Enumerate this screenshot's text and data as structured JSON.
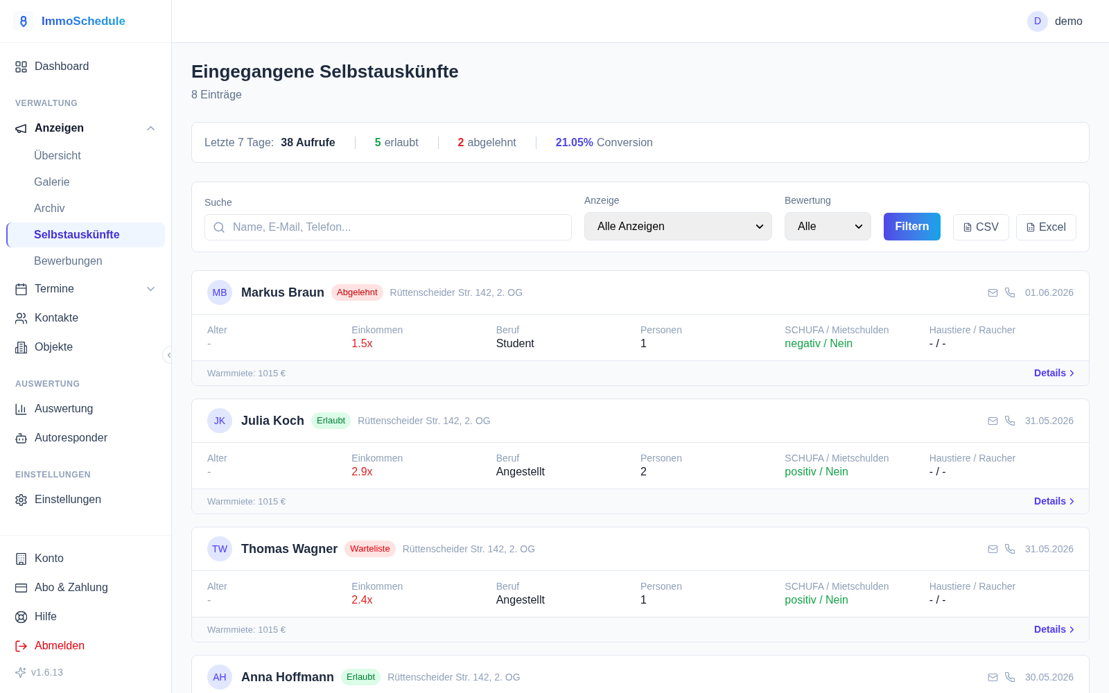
{
  "brand": {
    "name": "ImmoSchedule"
  },
  "sidebar": {
    "top": [
      {
        "label": "Dashboard",
        "selected": false
      }
    ],
    "groups": [
      {
        "heading": "VERWALTUNG",
        "items": [
          {
            "label": "Anzeigen",
            "selected": false,
            "expanded": true,
            "children": [
              {
                "label": "Übersicht",
                "selected": false
              },
              {
                "label": "Galerie",
                "selected": false
              },
              {
                "label": "Archiv",
                "selected": false
              },
              {
                "label": "Selbstauskünfte",
                "selected": true
              },
              {
                "label": "Bewerbungen",
                "selected": false
              }
            ]
          },
          {
            "label": "Termine",
            "selected": false,
            "expanded": false
          },
          {
            "label": "Kontakte",
            "selected": false
          },
          {
            "label": "Objekte",
            "selected": false
          }
        ]
      },
      {
        "heading": "AUSWERTUNG",
        "items": [
          {
            "label": "Auswertung",
            "selected": false
          },
          {
            "label": "Autoresponder",
            "selected": false
          }
        ]
      },
      {
        "heading": "EINSTELLUNGEN",
        "items": [
          {
            "label": "Einstellungen",
            "selected": false
          }
        ]
      }
    ],
    "bottom": [
      {
        "label": "Konto",
        "kind": "normal"
      },
      {
        "label": "Abo & Zahlung",
        "kind": "normal"
      },
      {
        "label": "Hilfe",
        "kind": "normal"
      },
      {
        "label": "Abmelden",
        "kind": "danger"
      }
    ],
    "version": "v1.6.13"
  },
  "user": {
    "initial": "D",
    "name": "demo"
  },
  "page": {
    "title": "Eingegangene Selbstauskünfte",
    "subtitle": "8 Einträge"
  },
  "stats": {
    "label": "Letzte 7 Tage:",
    "total": "38 Aufrufe",
    "items": [
      {
        "value": "5",
        "label": "erlaubt",
        "color": "#16a34a"
      },
      {
        "value": "2",
        "label": "abgelehnt",
        "color": "#dc2626"
      },
      {
        "value": "21.05%",
        "label": "Conversion",
        "color": "#4f46e5"
      }
    ]
  },
  "filters": {
    "search": {
      "label": "Suche",
      "placeholder": "Name, E-Mail, Telefon..."
    },
    "dropdowns": [
      {
        "label": "Anzeige",
        "value": "Alle Anzeigen"
      },
      {
        "label": "Bewertung",
        "value": "Alle"
      }
    ],
    "submit": "Filtern",
    "exports": [
      {
        "label": "CSV",
        "kind": "text"
      },
      {
        "label": "Excel",
        "kind": "sheet"
      }
    ]
  },
  "entries": [
    {
      "initials": "MB",
      "name": "Markus Braun",
      "status": {
        "label": "Abgelehnt",
        "kind": "rejected"
      },
      "address": "Rüttenscheider Str. 142, 2. OG",
      "date": "01.06.2026",
      "fields": [
        {
          "label": "Alter",
          "value": "-",
          "color": "#9ca3af"
        },
        {
          "label": "Einkommen",
          "value": "1.5x",
          "color": "#dc2626"
        },
        {
          "label": "Beruf",
          "value": "Student",
          "color": "#111827"
        },
        {
          "label": "Personen",
          "value": "1",
          "color": "#111827"
        },
        {
          "label": "SCHUFA / Mietschulden",
          "value": "negativ / Nein",
          "color": "#16a34a"
        },
        {
          "label": "Haustiere / Raucher",
          "value": "- / -",
          "color": "#111827"
        }
      ],
      "rent": "Warmmiete: 1015 €",
      "details": "Details"
    },
    {
      "initials": "JK",
      "name": "Julia Koch",
      "status": {
        "label": "Erlaubt",
        "kind": "approved"
      },
      "address": "Rüttenscheider Str. 142, 2. OG",
      "date": "31.05.2026",
      "fields": [
        {
          "label": "Alter",
          "value": "-",
          "color": "#9ca3af"
        },
        {
          "label": "Einkommen",
          "value": "2.9x",
          "color": "#dc2626"
        },
        {
          "label": "Beruf",
          "value": "Angestellt",
          "color": "#111827"
        },
        {
          "label": "Personen",
          "value": "2",
          "color": "#111827"
        },
        {
          "label": "SCHUFA / Mietschulden",
          "value": "positiv / Nein",
          "color": "#16a34a"
        },
        {
          "label": "Haustiere / Raucher",
          "value": "- / -",
          "color": "#111827"
        }
      ],
      "rent": "Warmmiete: 1015 €",
      "details": "Details"
    },
    {
      "initials": "TW",
      "name": "Thomas Wagner",
      "status": {
        "label": "Warteliste",
        "kind": "waitlist"
      },
      "address": "Rüttenscheider Str. 142, 2. OG",
      "date": "31.05.2026",
      "fields": [
        {
          "label": "Alter",
          "value": "-",
          "color": "#9ca3af"
        },
        {
          "label": "Einkommen",
          "value": "2.4x",
          "color": "#dc2626"
        },
        {
          "label": "Beruf",
          "value": "Angestellt",
          "color": "#111827"
        },
        {
          "label": "Personen",
          "value": "1",
          "color": "#111827"
        },
        {
          "label": "SCHUFA / Mietschulden",
          "value": "positiv / Nein",
          "color": "#16a34a"
        },
        {
          "label": "Haustiere / Raucher",
          "value": "- / -",
          "color": "#111827"
        }
      ],
      "rent": "Warmmiete: 1015 €",
      "details": "Details"
    },
    {
      "initials": "AH",
      "name": "Anna Hoffmann",
      "status": {
        "label": "Erlaubt",
        "kind": "approved"
      },
      "address": "Rüttenscheider Str. 142, 2. OG",
      "date": "30.05.2026"
    }
  ]
}
